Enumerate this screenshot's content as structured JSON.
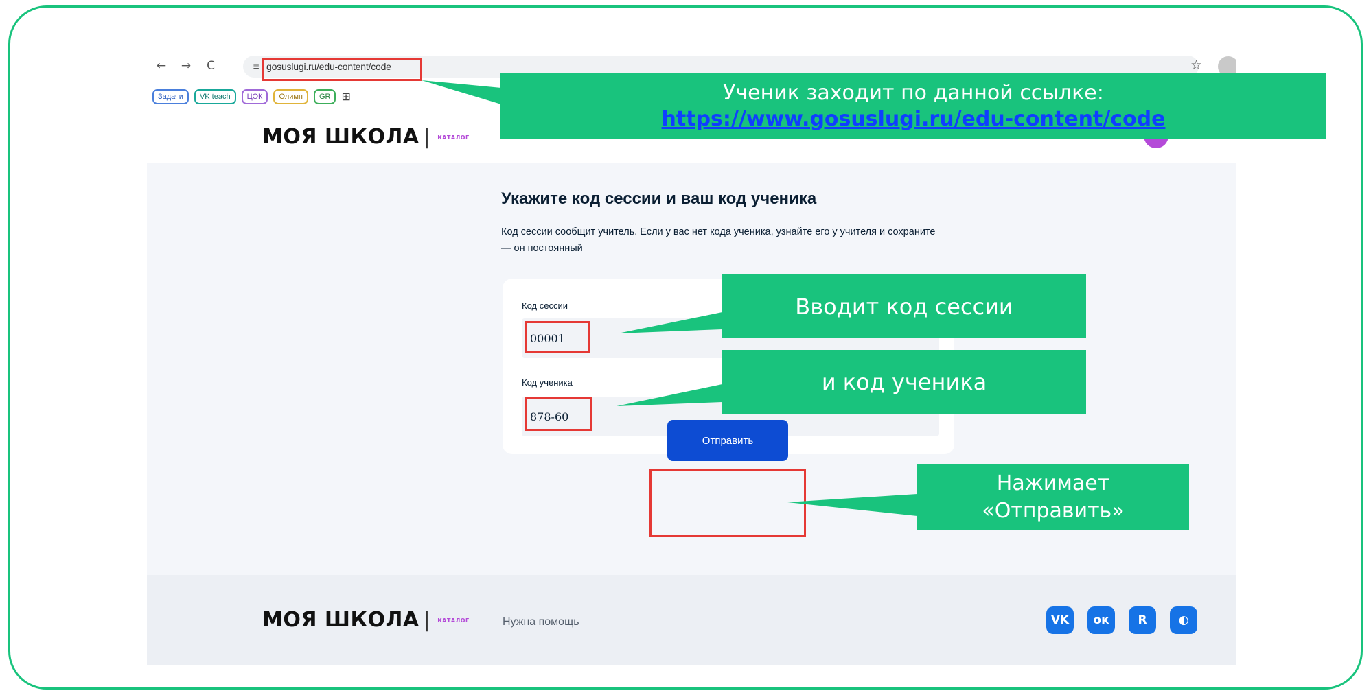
{
  "browser": {
    "url": "gosuslugi.ru/edu-content/code",
    "back_icon": "←",
    "forward_icon": "→",
    "reload_icon": "C",
    "site_info_icon": "≡",
    "star_icon": "☆",
    "apps_icon": "⊞",
    "bookmarks": [
      {
        "label": "Задачи",
        "color": "#4a7fdc"
      },
      {
        "label": "VK teach",
        "color": "#19a89a"
      },
      {
        "label": "ЦОК",
        "color": "#a06ad8"
      },
      {
        "label": "Олимп",
        "color": "#e0b43a"
      },
      {
        "label": "GR",
        "color": "#3cae5a"
      }
    ]
  },
  "header": {
    "logo_text": "МОЯ ШКОЛА",
    "logo_separator": "|",
    "logo_badge": "КАТАЛОГ"
  },
  "main": {
    "title": "Укажите код сессии и ваш код ученика",
    "description": "Код сессии сообщит учитель. Если у вас нет кода ученика, узнайте его у учителя и сохраните — он постоянный",
    "session_field": {
      "label": "Код сессии",
      "value": "00001"
    },
    "student_field": {
      "label": "Код ученика",
      "value": "878-60"
    },
    "submit_label": "Отправить"
  },
  "footer": {
    "logo_text": "МОЯ ШКОЛА",
    "logo_separator": "|",
    "logo_badge": "КАТАЛОГ",
    "help_link": "Нужна помощь",
    "social": [
      {
        "name": "vk",
        "glyph": "VK"
      },
      {
        "name": "ok",
        "glyph": "ок"
      },
      {
        "name": "rutube",
        "glyph": "R"
      },
      {
        "name": "dzen",
        "glyph": "◐"
      }
    ]
  },
  "callouts": {
    "link_line1": "Ученик заходит по данной ссылке:",
    "link_url": "https://www.gosuslugi.ru/edu-content/code",
    "session": "Вводит код сессии",
    "student": "и код ученика",
    "submit_line1": "Нажимает",
    "submit_line2": "«Отправить»"
  },
  "colors": {
    "accent_green": "#19c37d",
    "button_blue": "#0d4cd3",
    "highlight_red": "#e53935",
    "brand_purple": "#b44ad8"
  }
}
